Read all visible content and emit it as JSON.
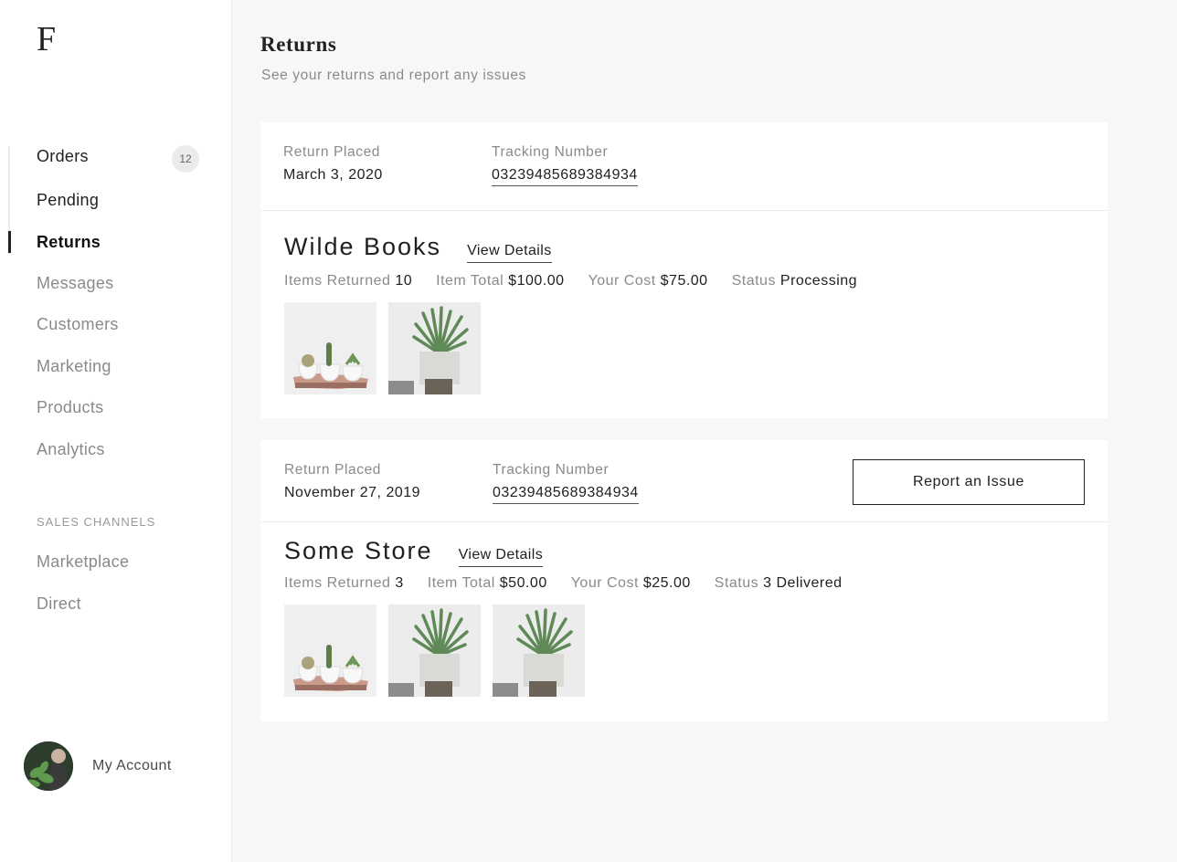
{
  "brand": {
    "logo_letter": "F"
  },
  "sidebar": {
    "items": [
      {
        "label": "Orders",
        "badge": "12"
      },
      {
        "label": "Pending"
      },
      {
        "label": "Returns"
      },
      {
        "label": "Messages"
      },
      {
        "label": "Customers"
      },
      {
        "label": "Marketing"
      },
      {
        "label": "Products"
      },
      {
        "label": "Analytics"
      }
    ],
    "section_label": "SALES CHANNELS",
    "channels": [
      {
        "label": "Marketplace"
      },
      {
        "label": "Direct"
      }
    ],
    "account_label": "My Account"
  },
  "page": {
    "title": "Returns",
    "subtitle": "See your returns and report any issues"
  },
  "labels": {
    "return_placed": "Return Placed",
    "tracking_number": "Tracking Number",
    "view_details": "View Details",
    "items_returned": "Items Returned",
    "item_total": "Item Total",
    "your_cost": "Your Cost",
    "status": "Status",
    "report_issue": "Report an Issue"
  },
  "returns": [
    {
      "placed": "March 3, 2020",
      "tracking": "03239485689384934",
      "store": "Wilde Books",
      "items_returned": "10",
      "item_total": "$100.00",
      "your_cost": "$75.00",
      "status": "Processing",
      "thumbnails": [
        "cactus-trio-icon",
        "succulent-pot-icon"
      ]
    },
    {
      "placed": "November 27, 2019",
      "tracking": "03239485689384934",
      "store": "Some Store",
      "items_returned": "3",
      "item_total": "$50.00",
      "your_cost": "$25.00",
      "status": "3 Delivered",
      "thumbnails": [
        "cactus-trio-icon",
        "succulent-pot-icon",
        "succulent-pot-icon"
      ]
    }
  ],
  "colors": {
    "accent": "#222222",
    "muted": "#8a8a8a",
    "background": "#f7f7f7"
  }
}
